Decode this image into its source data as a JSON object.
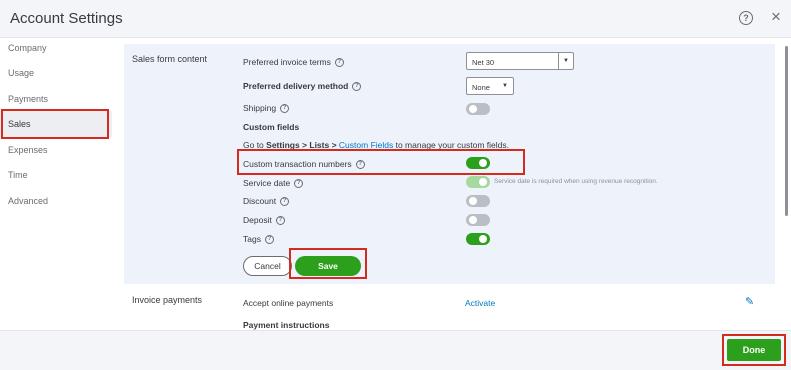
{
  "header": {
    "title": "Account Settings",
    "help_icon": "help-circle-icon",
    "close_icon": "close-icon",
    "close_glyph": "×"
  },
  "sidebar": {
    "items": [
      {
        "label": "Company"
      },
      {
        "label": "Usage"
      },
      {
        "label": "Payments"
      },
      {
        "label": "Sales",
        "active": true
      },
      {
        "label": "Expenses"
      },
      {
        "label": "Time"
      },
      {
        "label": "Advanced"
      }
    ]
  },
  "sales_form": {
    "section_label": "Sales form content",
    "preferred_invoice_terms": {
      "label": "Preferred invoice terms",
      "value": "Net 30"
    },
    "preferred_delivery_method": {
      "label": "Preferred delivery method",
      "value": "None"
    },
    "shipping": {
      "label": "Shipping",
      "on": false
    },
    "custom_fields": {
      "heading": "Custom fields",
      "text_prefix": "Go to ",
      "path": "Settings > Lists >",
      "link": "Custom Fields",
      "text_suffix": " to manage your custom fields."
    },
    "custom_transaction_numbers": {
      "label": "Custom transaction numbers",
      "on": true
    },
    "service_date": {
      "label": "Service date",
      "on": true,
      "note": "Service date is required when using revenue recognition."
    },
    "discount": {
      "label": "Discount",
      "on": false
    },
    "deposit": {
      "label": "Deposit",
      "on": false
    },
    "tags": {
      "label": "Tags",
      "on": true
    },
    "cancel_label": "Cancel",
    "save_label": "Save"
  },
  "invoice_payments": {
    "section_label": "Invoice payments",
    "accept_online_payments": "Accept online payments",
    "activate_link": "Activate",
    "payment_instructions": "Payment instructions",
    "edit_icon": "pencil-icon"
  },
  "footer": {
    "done_label": "Done"
  },
  "colors": {
    "accent_green": "#2ca01c",
    "link_blue": "#0077c5",
    "highlight_red": "#d52b1e",
    "panel_bg": "#eef3fb"
  }
}
